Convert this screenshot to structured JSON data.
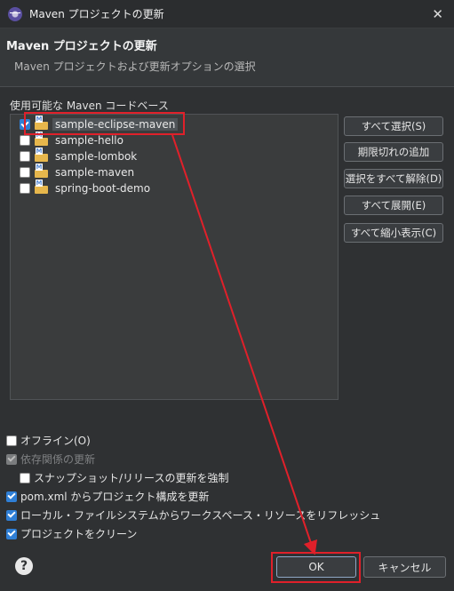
{
  "window": {
    "title": "Maven プロジェクトの更新",
    "close_label": "✕"
  },
  "header": {
    "title": "Maven プロジェクトの更新",
    "subtitle": "Maven プロジェクトおよび更新オプションの選択"
  },
  "codebase": {
    "label": "使用可能な Maven コードベース",
    "items": [
      {
        "name": "sample-eclipse-maven",
        "checked": true
      },
      {
        "name": "sample-hello",
        "checked": false
      },
      {
        "name": "sample-lombok",
        "checked": false
      },
      {
        "name": "sample-maven",
        "checked": false
      },
      {
        "name": "spring-boot-demo",
        "checked": false
      }
    ]
  },
  "side_buttons": {
    "select_all": "すべて選択(S)",
    "add_outdated": "期限切れの追加",
    "deselect_all": "選択をすべて解除(D)",
    "expand_all": "すべて展開(E)",
    "collapse_all": "すべて縮小表示(C)"
  },
  "options": {
    "offline": "オフライン(O)",
    "update_deps": "依存関係の更新",
    "force_update_snapshots": "スナップショット/リリースの更新を強制",
    "update_config": "pom.xml からプロジェクト構成を更新",
    "refresh_local": "ローカル・ファイルシステムからワークスペース・リソースをリフレッシュ",
    "clean_projects": "プロジェクトをクリーン"
  },
  "footer": {
    "help": "?",
    "ok": "OK",
    "cancel": "キャンセル"
  },
  "colors": {
    "highlight": "#e0202a",
    "check": "#2f7fd6"
  }
}
